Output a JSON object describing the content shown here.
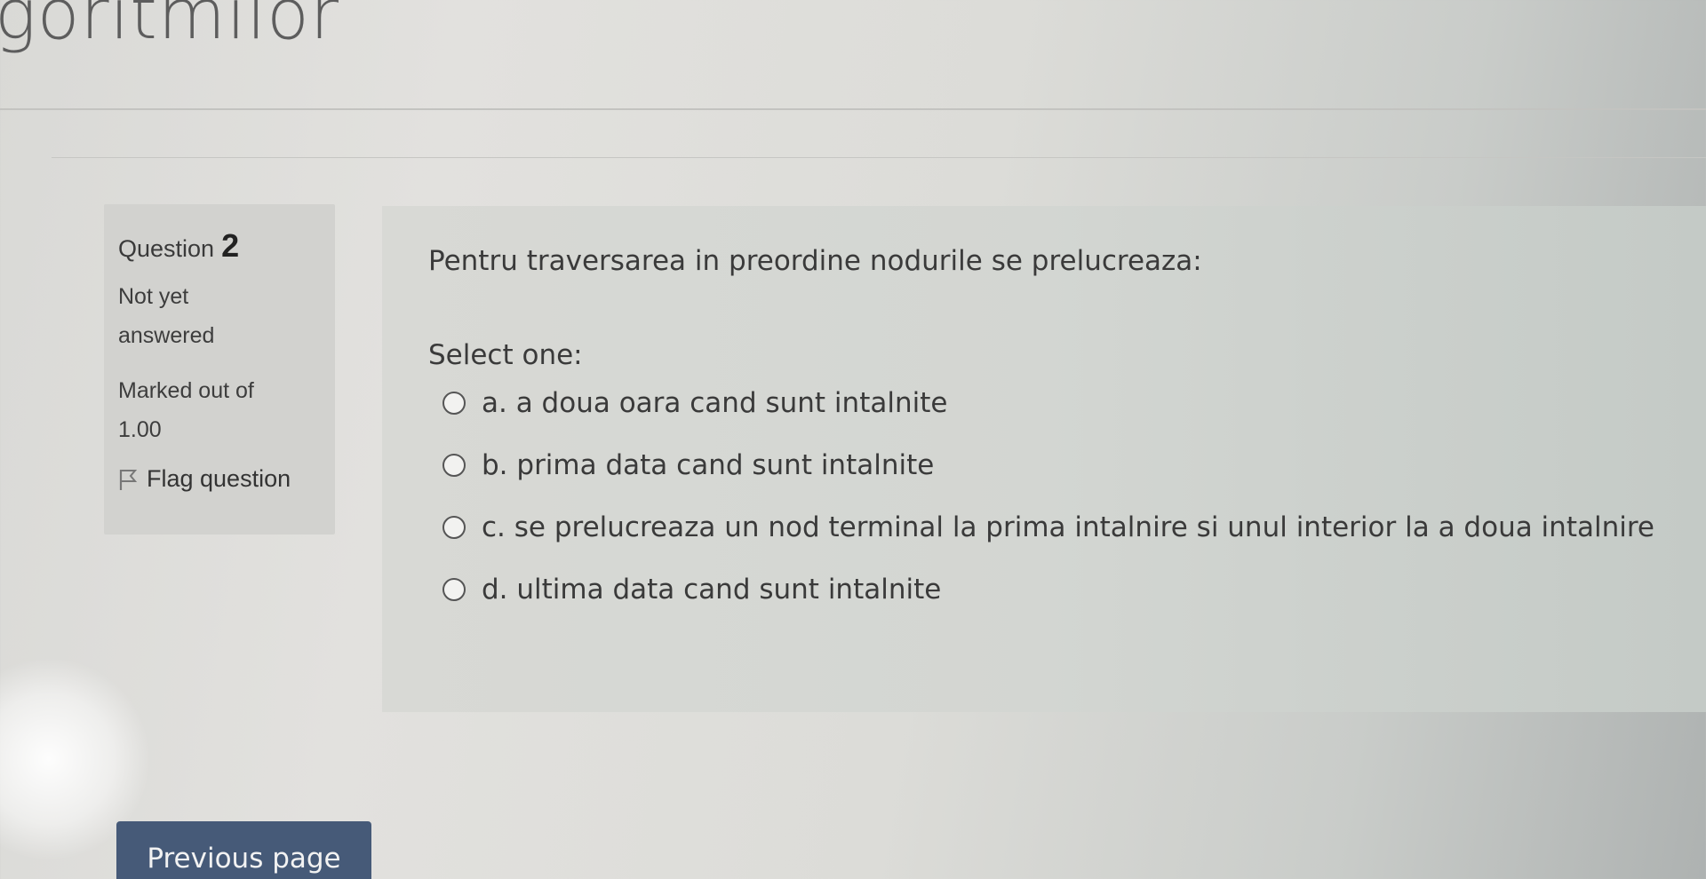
{
  "header": {
    "site_title": "goritmilor"
  },
  "question_info": {
    "label": "Question",
    "number": "2",
    "status_line1": "Not yet",
    "status_line2": "answered",
    "marks_line1": "Marked out of",
    "marks_line2": "1.00",
    "flag_label": "Flag question"
  },
  "question": {
    "text": "Pentru traversarea in preordine nodurile se prelucreaza:",
    "select_prompt": "Select one:",
    "options": [
      {
        "label": "a. a doua oara cand sunt intalnite",
        "selected": false
      },
      {
        "label": "b. prima data cand sunt intalnite",
        "selected": false
      },
      {
        "label": "c. se prelucreaza un nod terminal la prima intalnire si unul interior la a doua intalnire",
        "selected": false
      },
      {
        "label": "d. ultima data cand sunt intalnite",
        "selected": false
      }
    ]
  },
  "navigation": {
    "previous_label": "Previous page"
  },
  "colors": {
    "button_bg": "#465a78",
    "panel_bg": "#d2d2cf"
  },
  "icons": {
    "flag": "flag-icon",
    "radio": "radio-empty-icon"
  }
}
